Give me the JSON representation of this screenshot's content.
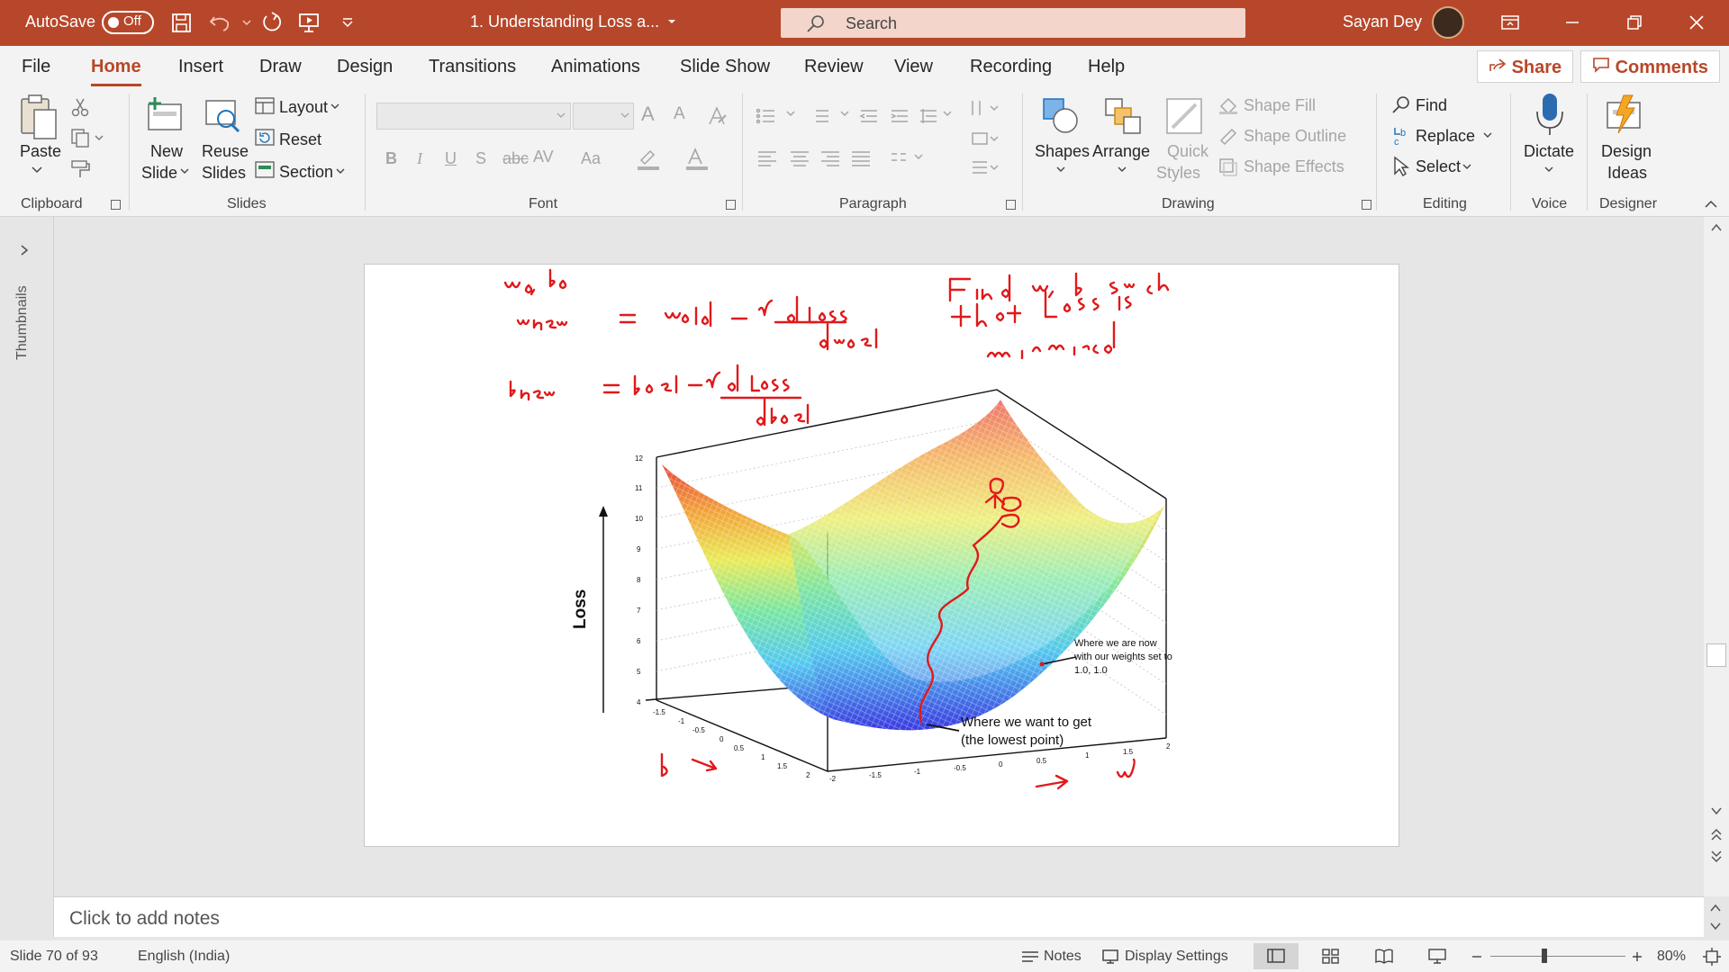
{
  "titlebar": {
    "autosave_label": "AutoSave",
    "autosave_state": "Off",
    "doc_title": "1. Understanding Loss a...",
    "search_placeholder": "Search",
    "user_name": "Sayan Dey",
    "accent": "#b7472a"
  },
  "tabs": [
    "File",
    "Home",
    "Insert",
    "Draw",
    "Design",
    "Transitions",
    "Animations",
    "Slide Show",
    "Review",
    "View",
    "Recording",
    "Help"
  ],
  "active_tab": "Home",
  "share_label": "Share",
  "comments_label": "Comments",
  "ribbon": {
    "clipboard": {
      "paste": "Paste",
      "label": "Clipboard"
    },
    "slides": {
      "new_slide_1": "New",
      "new_slide_2": "Slide",
      "reuse_1": "Reuse",
      "reuse_2": "Slides",
      "layout": "Layout",
      "reset": "Reset",
      "section": "Section",
      "label": "Slides"
    },
    "font": {
      "label": "Font",
      "bold": "B",
      "italic": "I",
      "underline": "U",
      "strike": "S",
      "strike2": "abc",
      "spacing": "AV",
      "case": "Aa",
      "grow": "A",
      "shrink": "A"
    },
    "paragraph": {
      "label": "Paragraph"
    },
    "drawing": {
      "shapes": "Shapes",
      "arrange": "Arrange",
      "quick_1": "Quick",
      "quick_2": "Styles",
      "fill": "Shape Fill",
      "outline": "Shape Outline",
      "effects": "Shape Effects",
      "label": "Drawing"
    },
    "editing": {
      "find": "Find",
      "replace": "Replace",
      "select": "Select",
      "label": "Editing"
    },
    "voice": {
      "dictate": "Dictate",
      "label": "Voice"
    },
    "designer": {
      "ideas_1": "Design",
      "ideas_2": "Ideas",
      "label": "Designer"
    }
  },
  "left_pane": {
    "label": "Thumbnails"
  },
  "slide": {
    "chart": {
      "z_axis_label": "Loss",
      "z_ticks": [
        "12",
        "11",
        "10",
        "9",
        "8",
        "7",
        "6",
        "5",
        "4"
      ],
      "w_ticks": [
        "-2",
        "-1.5",
        "-1",
        "-0.5",
        "0",
        "0.5",
        "1",
        "1.5",
        "2"
      ],
      "b_ticks": [
        "-1.5",
        "-1",
        "-0.5",
        "0",
        "0.5",
        "1",
        "1.5",
        "2"
      ],
      "annotation_now_1": "Where we are now",
      "annotation_now_2": "with our weights set to",
      "annotation_now_3": "1.0, 1.0",
      "annotation_goal_1": "Where we want to get",
      "annotation_goal_2": "(the lowest point)"
    }
  },
  "notes_placeholder": "Click to add notes",
  "status": {
    "slide_counter": "Slide 70 of 93",
    "language": "English (India)",
    "notes": "Notes",
    "display_settings": "Display Settings",
    "zoom": "80%"
  }
}
